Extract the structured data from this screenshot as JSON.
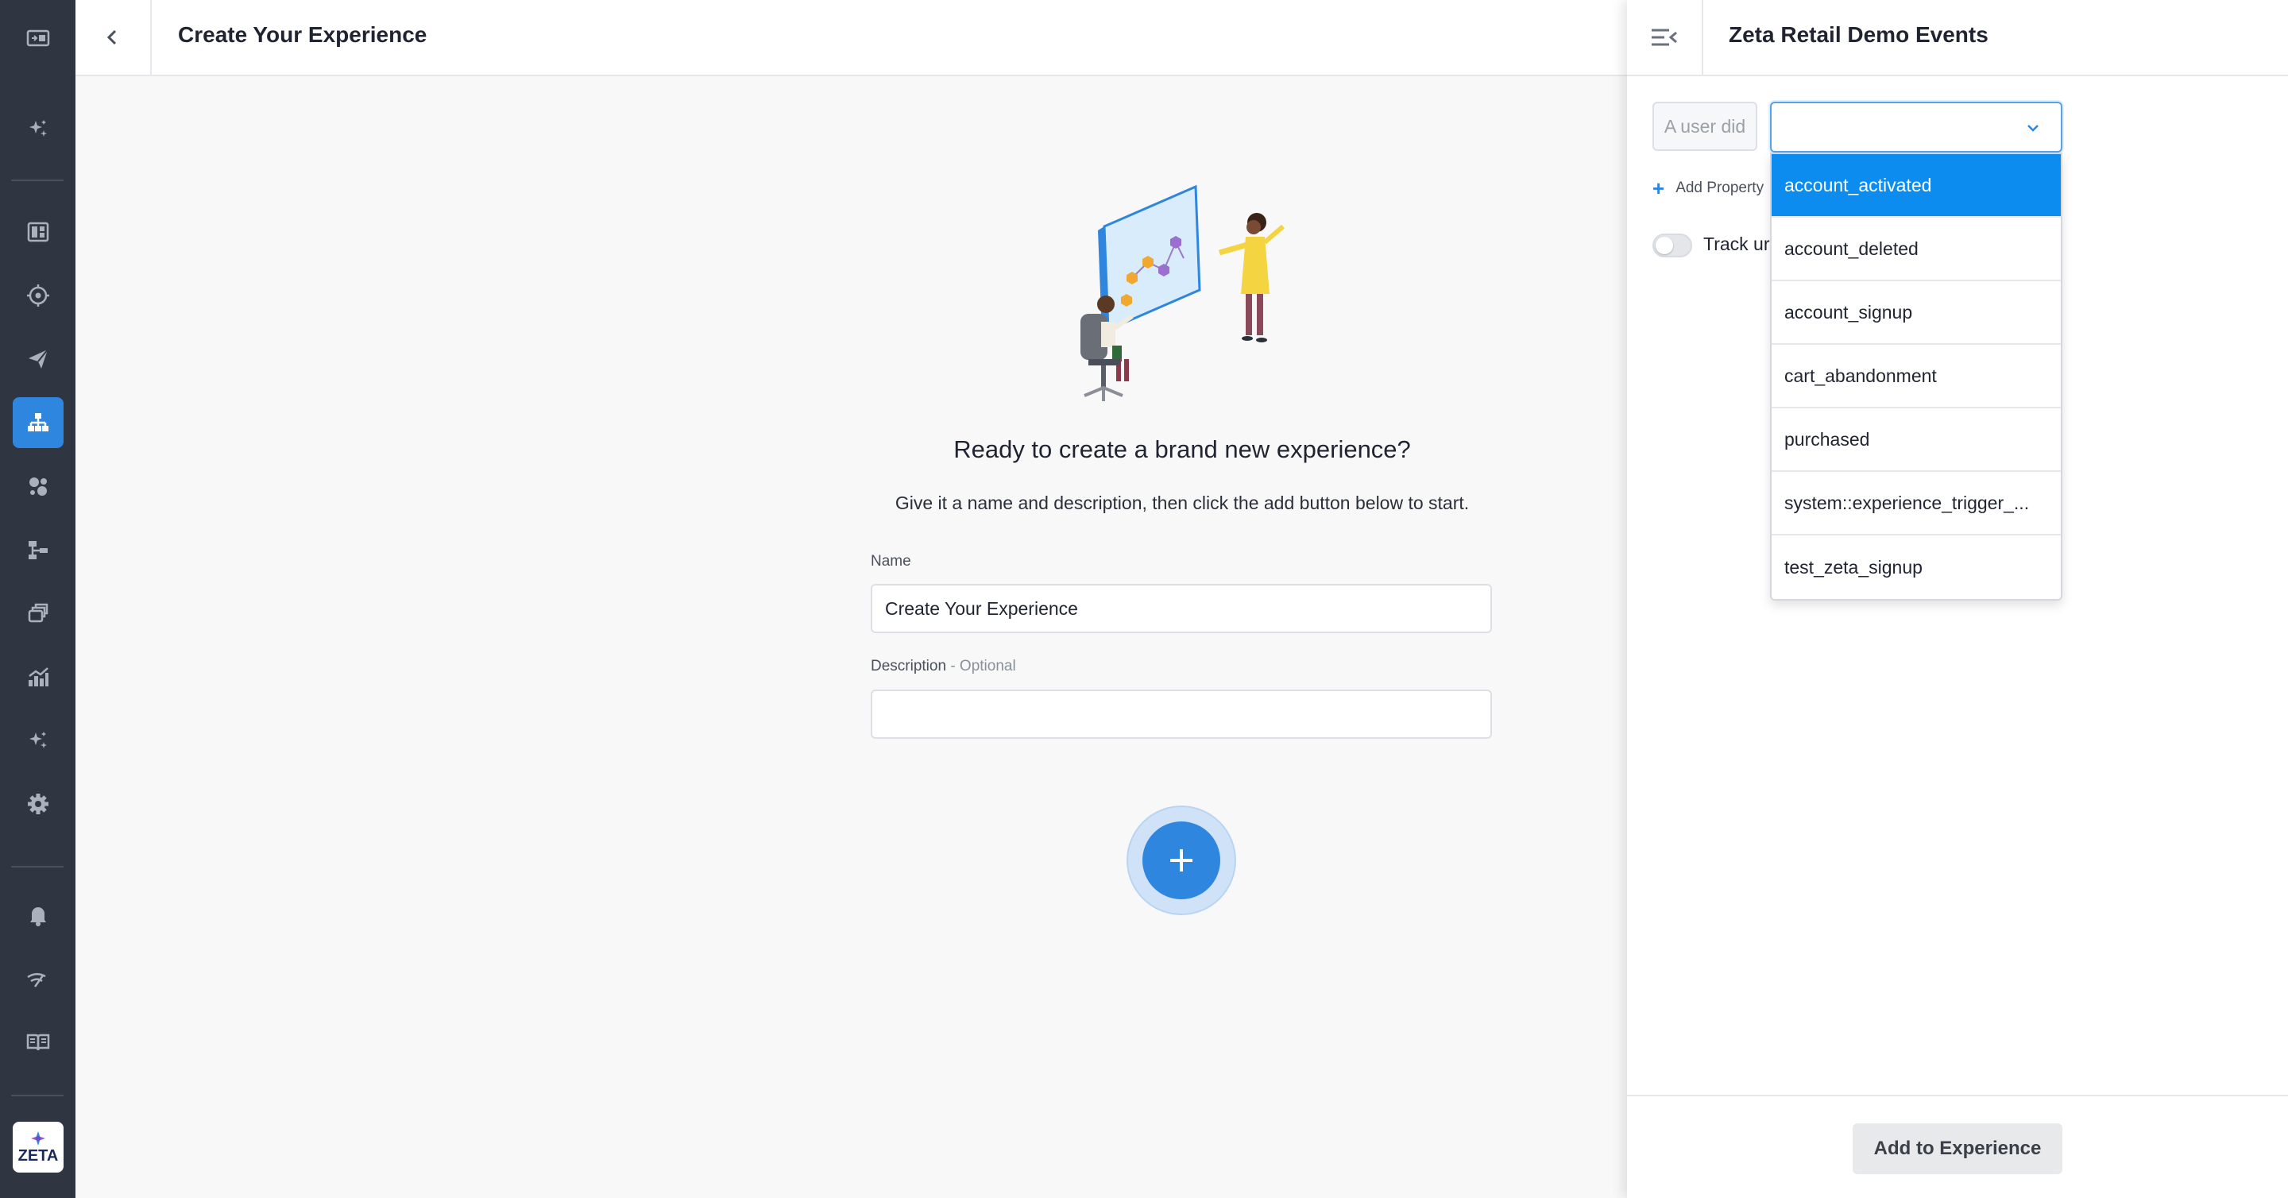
{
  "header": {
    "title": "Create Your Experience"
  },
  "main": {
    "heading": "Ready to create a brand new experience?",
    "subheading": "Give it a name and description, then click the add button below to start.",
    "name_label": "Name",
    "name_value": "Create Your Experience",
    "description_label": "Description",
    "description_optional": " - Optional",
    "description_value": ""
  },
  "sidebar": {
    "items": [
      {
        "icon": "switch-panel-icon"
      },
      {
        "icon": "sparkle-icon"
      },
      {
        "icon": "dashboard-icon"
      },
      {
        "icon": "target-icon"
      },
      {
        "icon": "paper-plane-icon"
      },
      {
        "icon": "hierarchy-icon",
        "active": true
      },
      {
        "icon": "audience-icon"
      },
      {
        "icon": "flow-icon"
      },
      {
        "icon": "stack-icon"
      },
      {
        "icon": "analytics-icon"
      },
      {
        "icon": "sparkle-icon"
      },
      {
        "icon": "gear-icon"
      },
      {
        "icon": "bell-icon"
      },
      {
        "icon": "signal-icon"
      },
      {
        "icon": "book-icon"
      }
    ],
    "logo_text": "ZETA"
  },
  "panel": {
    "title": "Zeta Retail Demo Events",
    "user_did": "A user did",
    "add_property": "Add Property",
    "track_label": "Track ur",
    "event_options": [
      "account_activated",
      "account_deleted",
      "account_signup",
      "cart_abandonment",
      "purchased",
      "system::experience_trigger_...",
      "test_zeta_signup"
    ],
    "selected_option": "account_activated",
    "add_button": "Add to Experience"
  },
  "colors": {
    "accent": "#2e86de",
    "sidebar_bg": "#2f3641",
    "selected_option_bg": "#0d8cf0"
  }
}
